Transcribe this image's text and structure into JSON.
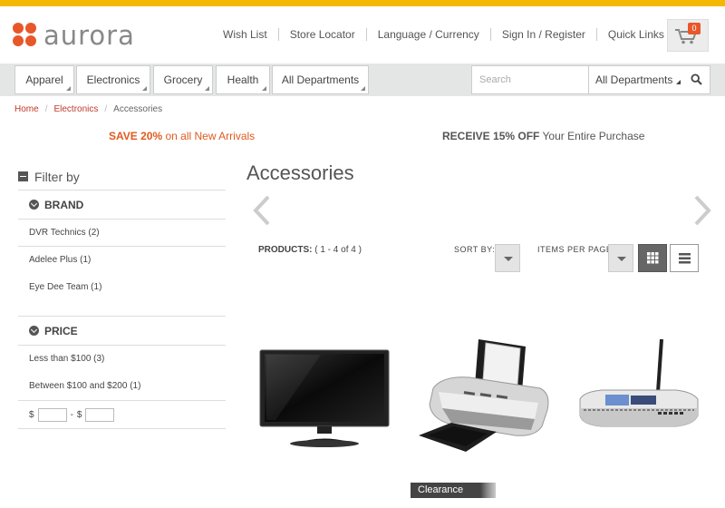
{
  "brand": {
    "name": "aurora",
    "accent": "#e8572a",
    "topbar_color": "#f5b800"
  },
  "header": {
    "links": [
      "Wish List",
      "Store Locator",
      "Language / Currency",
      "Sign In / Register",
      "Quick Links"
    ],
    "cart": {
      "count": "0",
      "icon": "cart-icon"
    }
  },
  "nav": {
    "departments": [
      "Apparel",
      "Electronics",
      "Grocery",
      "Health",
      "All Departments"
    ],
    "search": {
      "placeholder": "Search",
      "scope": "All Departments",
      "icon": "search-icon"
    }
  },
  "breadcrumb": {
    "items": [
      "Home",
      "Electronics"
    ],
    "current": "Accessories"
  },
  "promos": {
    "left_bold": "SAVE 20%",
    "left_rest": " on all New Arrivals",
    "right_bold": "RECEIVE 15% OFF",
    "right_rest": " Your Entire Purchase"
  },
  "sidebar": {
    "title": "Filter by",
    "brand": {
      "label": "BRAND",
      "items": [
        "DVR Technics (2)",
        "Adelee Plus (1)",
        "Eye Dee Team (1)"
      ]
    },
    "price": {
      "label": "PRICE",
      "items": [
        "Less than $100 (3)",
        "Between $100 and $200 (1)"
      ],
      "currency": "$",
      "dash": "-"
    }
  },
  "main": {
    "title": "Accessories",
    "products_label": "PRODUCTS:",
    "products_range": "( 1 - 4 of 4 )",
    "sort_label": "SORT BY:",
    "ipp_label": "ITEMS PER PAGE:",
    "badge": "Clearance",
    "products": [
      {
        "icon": "tv-image"
      },
      {
        "icon": "printer-image"
      },
      {
        "icon": "router-image"
      }
    ]
  }
}
